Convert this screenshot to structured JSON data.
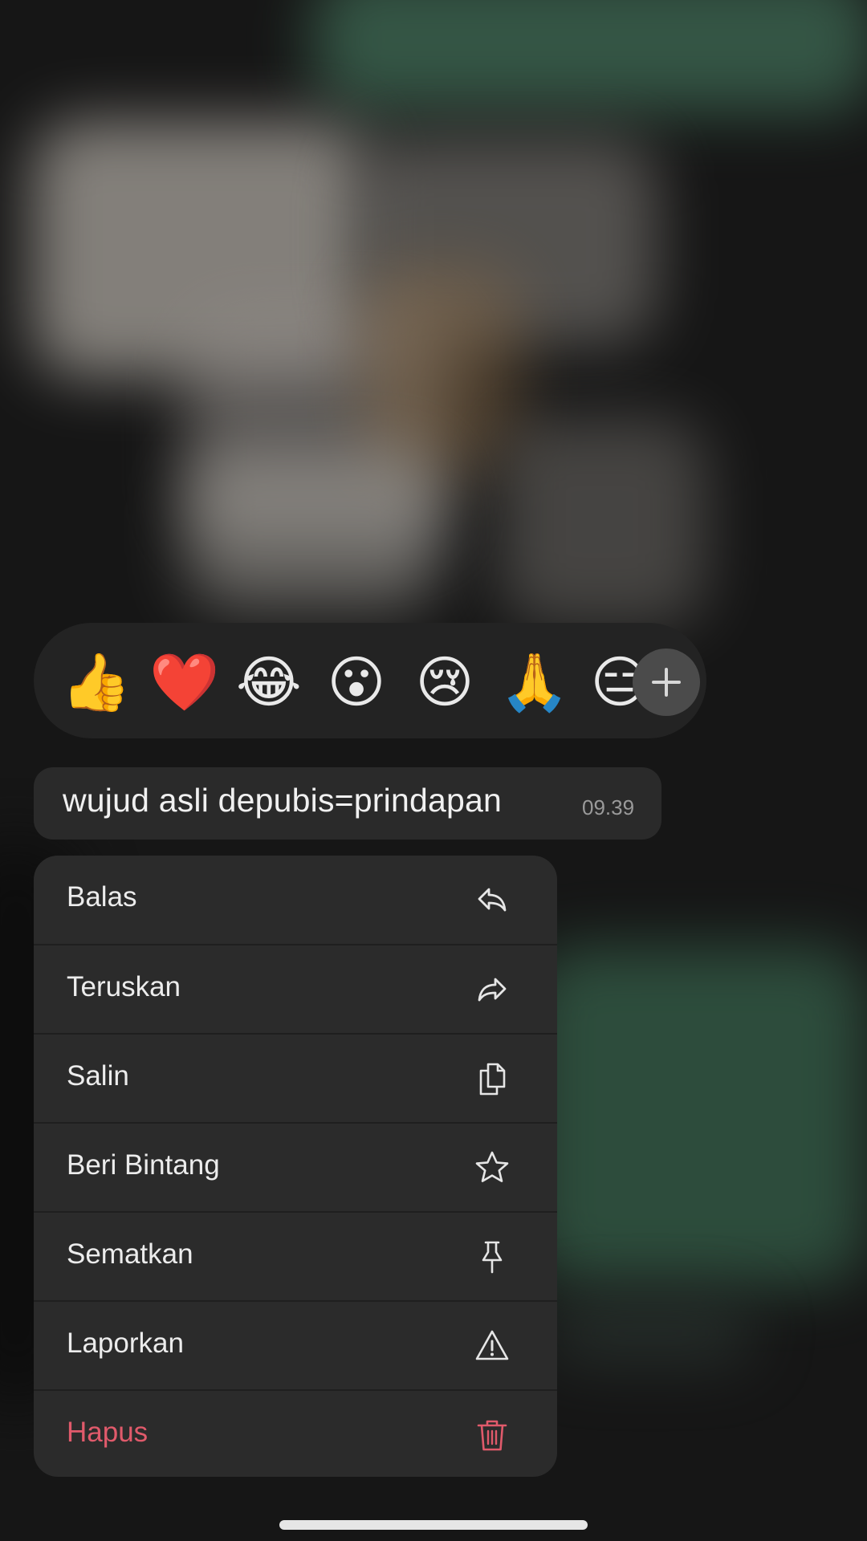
{
  "reactions": {
    "emojis": [
      "👍",
      "❤️",
      "😂",
      "😮",
      "😢",
      "🙏",
      "😑"
    ],
    "more_icon": "plus-icon"
  },
  "message": {
    "text": "wujud asli depubis=prindapan",
    "time": "09.39"
  },
  "menu": {
    "items": [
      {
        "label": "Balas",
        "icon": "reply-icon"
      },
      {
        "label": "Teruskan",
        "icon": "forward-icon"
      },
      {
        "label": "Salin",
        "icon": "copy-icon"
      },
      {
        "label": "Beri Bintang",
        "icon": "star-icon"
      },
      {
        "label": "Sematkan",
        "icon": "pin-icon"
      },
      {
        "label": "Laporkan",
        "icon": "warning-icon"
      },
      {
        "label": "Hapus",
        "icon": "trash-icon"
      }
    ]
  },
  "colors": {
    "danger": "#e05a6b",
    "menu_bg": "#2b2b2b",
    "text": "#ececec"
  }
}
